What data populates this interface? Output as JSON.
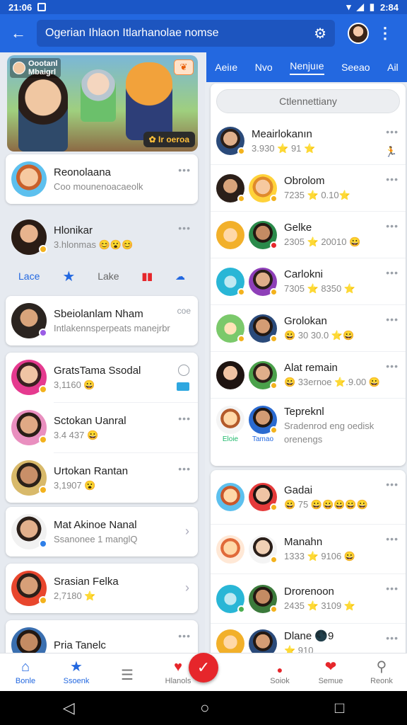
{
  "status": {
    "time": "21:06",
    "battery_time": "2:84"
  },
  "appbar": {
    "search_text": "Ogerian Ihlaon Itlarhanolae nomse"
  },
  "hero": {
    "tag_line1": "Oootanl",
    "tag_line2": "Mbaigrl",
    "pill": "Ir oeroa"
  },
  "left": {
    "first": {
      "name": "Reonolaana",
      "sub": "Coo mounenoacaeolk"
    },
    "second": {
      "name": "Hlonikar",
      "sub": "3.hlonmas 😊😮😊"
    },
    "actions": [
      "Lace",
      "Lake"
    ],
    "card1": {
      "name": "Sbeiolanlam Nham",
      "sub": "Intlakennsperpeats manejrbr",
      "right": "coe"
    },
    "group": [
      {
        "name": "GratsTama Ssodal",
        "sub": "3,1160 😀"
      },
      {
        "name": "Sctokan Uanral",
        "sub": "3.4 437 😀"
      },
      {
        "name": "Urtokan Rantan",
        "sub": "3,1907 😮"
      }
    ],
    "card2": {
      "name": "Mat Akinoe Nanal",
      "sub": "Ssanonee 1 manglQ"
    },
    "card3": {
      "name": "Srasian Felka",
      "sub": "2,7180 ⭐"
    },
    "card4": {
      "name": "Pria Tanelc",
      "sub": ""
    }
  },
  "tabs": [
    "Aeiıe",
    "Nvo",
    "Nenjuıe",
    "Seeao",
    "Ail"
  ],
  "right": {
    "search_placeholder": "Ctlennettiany",
    "rows": [
      {
        "name": "Meairlokanın",
        "sub": "3.930 ⭐ 91 ⭐"
      },
      {
        "name": "Obrolom",
        "sub": "7235 ⭐ 0.10⭐"
      },
      {
        "name": "Gelke",
        "sub": "2305 ⭐ 20010 😀"
      },
      {
        "name": "Carlokni",
        "sub": "7305 ⭐ 8350 ⭐"
      },
      {
        "name": "Grolokan",
        "sub": "😀 30 30.0 ⭐😀"
      },
      {
        "name": "Alat remain",
        "sub": "😀 33ernoe ⭐.9.00 😀"
      },
      {
        "name": "Tepreknl",
        "sub": "Sradenrod eng oedisk"
      }
    ],
    "row7_sub2": "orenengs",
    "row7_left_labels": [
      "Eloie",
      "Tamao"
    ],
    "panel2": [
      {
        "name": "Gadai",
        "sub": "😀 75 😀😀😀😀😀"
      },
      {
        "name": "Manahn",
        "sub": "1333 ⭐ 9106 😀"
      },
      {
        "name": "Drorenoon",
        "sub": "2435 ⭐ 3109 ⭐"
      },
      {
        "name": "Dlane 🌑9",
        "sub": "⭐ 910"
      }
    ]
  },
  "nav": [
    "Bonle",
    "Ssoenk",
    "",
    "Hlanols",
    "",
    "Soiok",
    "Semue",
    "Reonk"
  ],
  "colors": {
    "primary": "#2368e0",
    "fab": "#e6262b"
  }
}
